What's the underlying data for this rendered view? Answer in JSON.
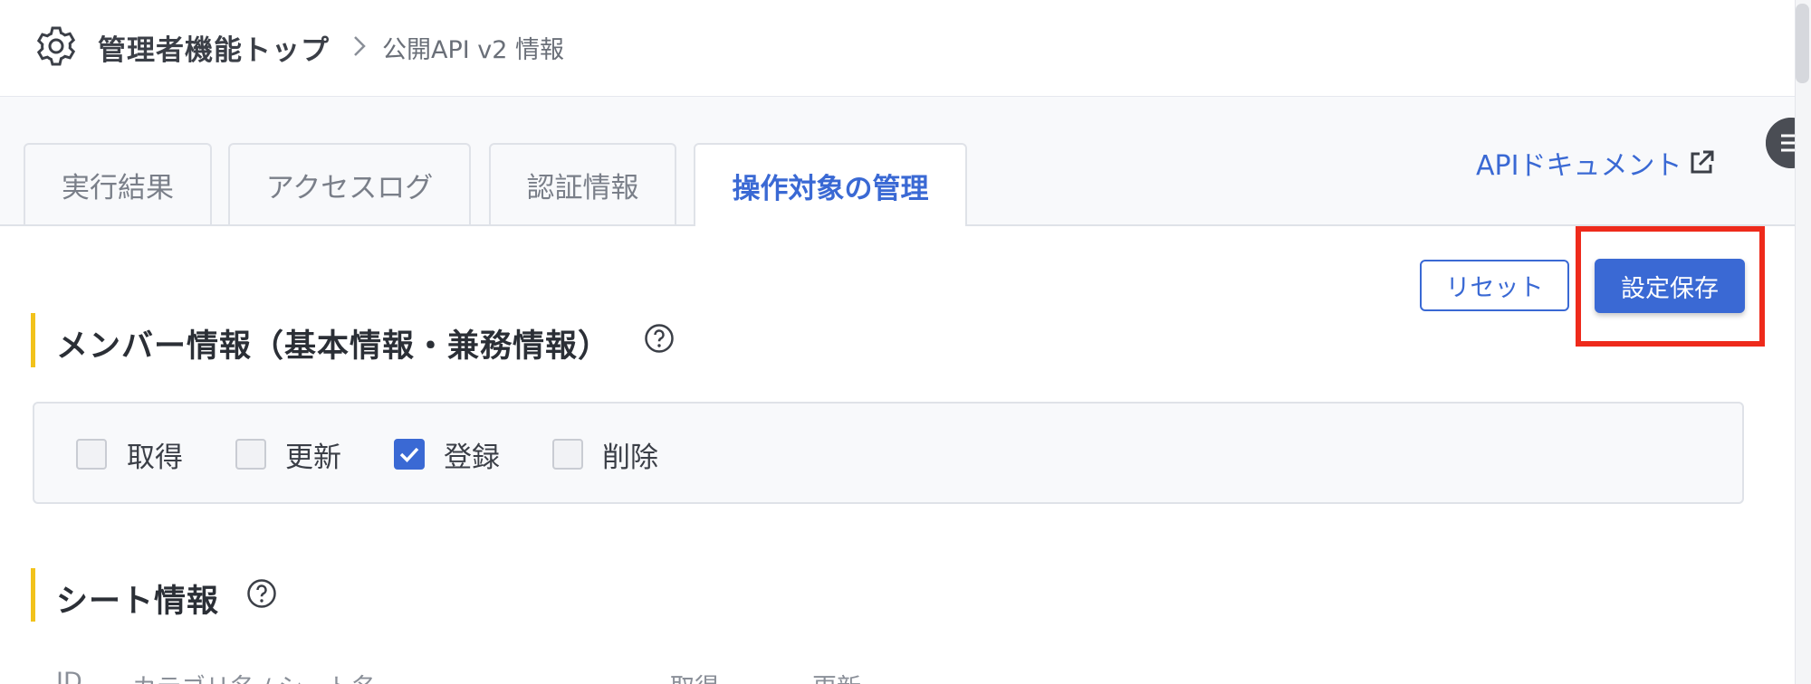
{
  "header": {
    "breadcrumb_root": "管理者機能トップ",
    "breadcrumb_current": "公開API v2 情報"
  },
  "tabs": [
    {
      "label": "実行結果",
      "active": false
    },
    {
      "label": "アクセスログ",
      "active": false
    },
    {
      "label": "認証情報",
      "active": false
    },
    {
      "label": "操作対象の管理",
      "active": true
    }
  ],
  "api_doc_link": "APIドキュメント",
  "actions": {
    "reset_label": "リセット",
    "save_label": "設定保存"
  },
  "member_section": {
    "title": "メンバー情報（基本情報・兼務情報）",
    "permissions": [
      {
        "label": "取得",
        "checked": false
      },
      {
        "label": "更新",
        "checked": false
      },
      {
        "label": "登録",
        "checked": true
      },
      {
        "label": "削除",
        "checked": false
      }
    ]
  },
  "sheet_section": {
    "title": "シート情報",
    "columns": [
      "ID",
      "カテゴリ名 / シート名",
      "取得",
      "更新"
    ]
  },
  "colors": {
    "accent": "#3a69d4",
    "section_marker": "#f2c21b",
    "highlight": "#ee2a1b"
  }
}
